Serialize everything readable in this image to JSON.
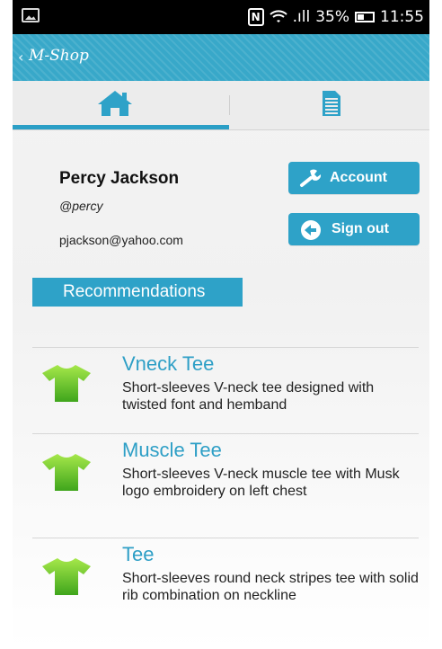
{
  "status_bar": {
    "signal_label": ".ıll",
    "battery": "35%",
    "time": "11:55"
  },
  "app_bar": {
    "title": "M-Shop"
  },
  "tabs": [
    {
      "icon": "home-icon",
      "selected": true
    },
    {
      "icon": "document-list-icon",
      "selected": false
    }
  ],
  "profile": {
    "name": "Percy Jackson",
    "handle": "@percy",
    "email": "pjackson@yahoo.com"
  },
  "buttons": {
    "account_label": "Account",
    "signout_label": "Sign out"
  },
  "recommendations": {
    "heading": "Recommendations",
    "items": [
      {
        "name": "Vneck Tee",
        "description": "Short-sleeves V-neck tee designed with twisted font and hemband"
      },
      {
        "name": "Muscle Tee",
        "description": "Short-sleeves V-neck muscle tee with Musk logo embroidery on left chest"
      },
      {
        "name": "Tee",
        "description": "Short-sleeves round neck stripes tee with solid rib combination on neckline"
      }
    ]
  },
  "colors": {
    "accent": "#2ea2c8",
    "product_title": "#2e9fc6",
    "tee_green_light": "#9be23a",
    "tee_green_dark": "#3fa51c"
  }
}
